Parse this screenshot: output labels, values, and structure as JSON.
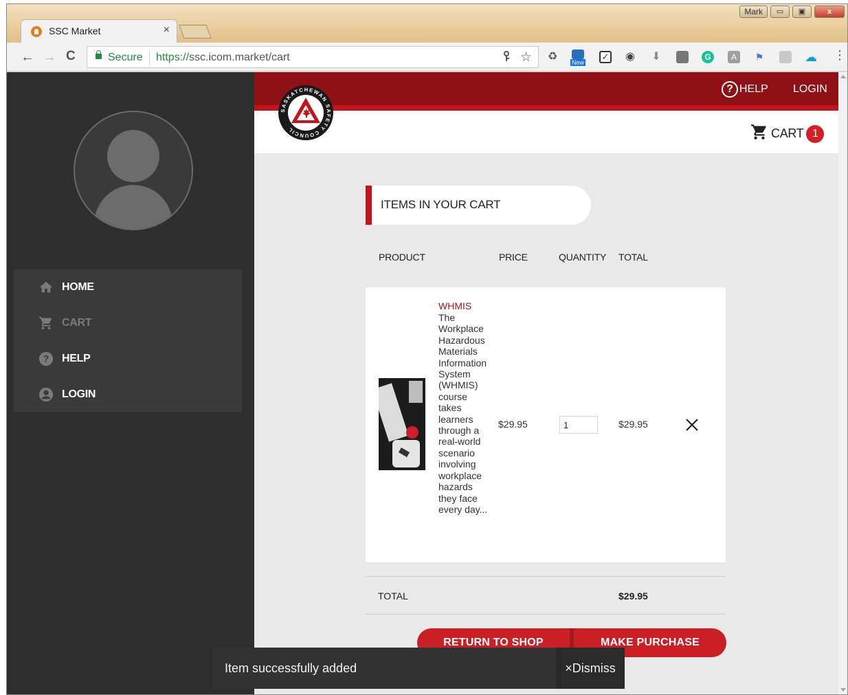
{
  "browser": {
    "tab_title": "SSC Market",
    "tab_close": "×",
    "window_user": "Mark",
    "win_minimize": "▭",
    "win_maximize": "▣",
    "win_close": "x",
    "back": "←",
    "forward": "→",
    "reload": "C",
    "secure_label": "Secure",
    "url_scheme": "https://",
    "url_rest": "ssc.icom.market/cart",
    "bookmark_star": "☆",
    "extensions": [
      "recycle-icon",
      "new-tab-icon",
      "checkbox-icon",
      "eye-icon",
      "download-icon",
      "square-icon",
      "grammarly-icon",
      "translate-icon",
      "flag-icon",
      "pdf-icon",
      "salesforce-icon"
    ],
    "ext_new_badge": "New",
    "menu_dots": "⋮"
  },
  "sidebar": {
    "items": [
      {
        "label": "HOME",
        "icon": "home-icon",
        "enabled": true
      },
      {
        "label": "CART",
        "icon": "cart-icon",
        "enabled": false
      },
      {
        "label": "HELP",
        "icon": "help-icon",
        "enabled": true
      },
      {
        "label": "LOGIN",
        "icon": "account-icon",
        "enabled": true
      }
    ]
  },
  "header": {
    "help_icon": "?",
    "help_label": "HELP",
    "login_label": "LOGIN",
    "cart_label": "CART",
    "cart_count": "1",
    "logo_text": "SASKATCHEWAN SAFETY COUNCIL"
  },
  "cart": {
    "section_title": "ITEMS IN YOUR CART",
    "columns": {
      "product": "PRODUCT",
      "price": "PRICE",
      "quantity": "QUANTITY",
      "total": "TOTAL"
    },
    "items": [
      {
        "name": "WHMIS",
        "description": "The Workplace Hazardous Materials Information System (WHMIS) course takes learners through a real-world scenario involving workplace hazards they face every day...",
        "price": "$29.95",
        "quantity": "1",
        "total": "$29.95"
      }
    ],
    "total_label": "TOTAL",
    "total_value": "$29.95",
    "return_button": "RETURN TO SHOP",
    "purchase_button": "MAKE PURCHASE"
  },
  "snackbar": {
    "message": "Item successfully added",
    "action_icon": "×",
    "action_label": "Dismiss"
  },
  "colors": {
    "brand_dark_red": "#8f1015",
    "brand_red": "#c3141c",
    "button_red": "#c91f25",
    "sidebar_bg": "#2e2e2e",
    "page_bg": "#e9e9e9"
  }
}
